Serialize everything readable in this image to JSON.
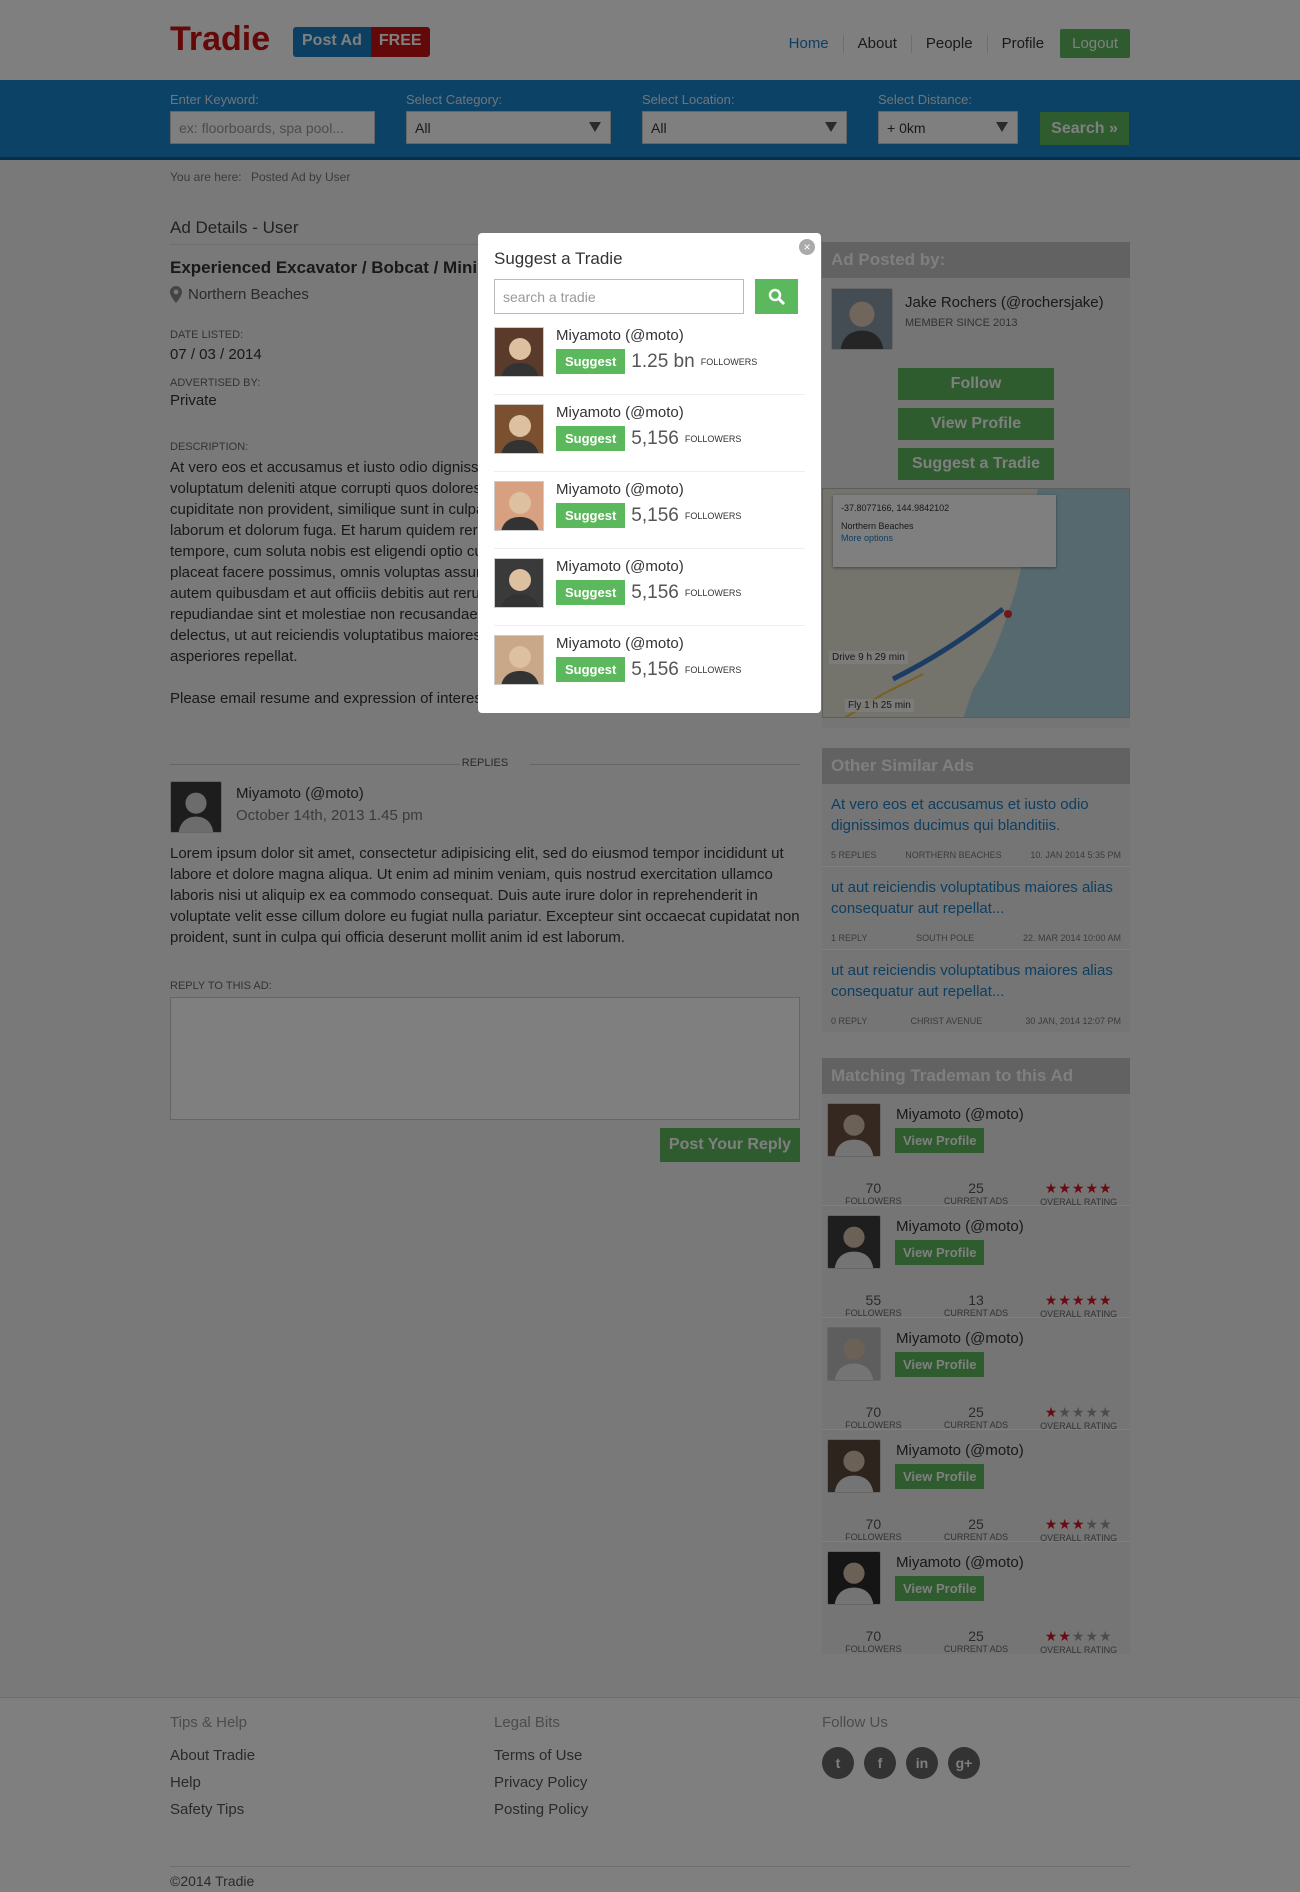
{
  "header": {
    "logo": "Tradie",
    "post_ad": "Post Ad",
    "free": "FREE",
    "nav": [
      "Home",
      "About",
      "People",
      "Profile"
    ],
    "logout": "Logout"
  },
  "search": {
    "keyword_label": "Enter Keyword:",
    "keyword_placeholder": "ex: floorboards, spa pool...",
    "category_label": "Select Category:",
    "category_value": "All",
    "location_label": "Select Location:",
    "location_value": "All",
    "distance_label": "Select Distance:",
    "distance_value": "+ 0km",
    "button": "Search »"
  },
  "breadcrumb": {
    "prefix": "You are here:",
    "current": "Posted Ad by User"
  },
  "ad": {
    "section_title": "Ad Details - User",
    "title": "Experienced Excavator / Bobcat / Mini",
    "location": "Northern Beaches",
    "date_label": "DATE LISTED:",
    "date": "07 / 03 / 2014",
    "advertised_label": "ADVERTISED BY:",
    "advertised": "Private",
    "desc_label": "DESCRIPTION:",
    "description": "At vero eos et accusamus et iusto odio dignissimos ducimus qui blanditiis praesentium voluptatum deleniti atque corrupti quos dolores et quas molestias excepturi sint occaecati cupiditate non provident, similique sunt in culpa qui officia deserunt mollitia animi, id est laborum et dolorum fuga. Et harum quidem rerum facilis est et expedita distinctio. Nam libero tempore, cum soluta nobis est eligendi optio cumque nihil impedit quo minus id quod maxime placeat facere possimus, omnis voluptas assumenda est, omnis dolor repellendus. Temporibus autem quibusdam et aut officiis debitis aut rerum necessitatibus saepe eveniet ut et voluptates repudiandae sint et molestiae non recusandae. Itaque earum rerum hic tenetur a sapiente delectus, ut aut reiciendis voluptatibus maiores alias consequatur aut perferendis doloribus asperiores repellat.",
    "email_note": "Please email resume and expression of interest."
  },
  "replies": {
    "label": "REPLIES",
    "author": "Miyamoto (@moto)",
    "date": "October 14th, 2013 1.45 pm",
    "body": "Lorem ipsum dolor sit amet, consectetur adipisicing elit, sed do eiusmod tempor incididunt ut labore et dolore magna aliqua. Ut enim ad minim veniam, quis nostrud exercitation ullamco laboris nisi ut aliquip ex ea commodo consequat. Duis aute irure dolor in reprehenderit in voluptate velit esse cillum dolore eu fugiat nulla pariatur. Excepteur sint occaecat cupidatat non proident, sunt in culpa qui officia deserunt mollit anim id est laborum.",
    "reply_label": "REPLY TO THIS AD:",
    "post_button": "Post Your Reply"
  },
  "poster": {
    "heading": "Ad Posted by:",
    "name": "Jake Rochers  (@rochersjake)",
    "since": "MEMBER SINCE 2013",
    "follow": "Follow",
    "view_profile": "View Profile",
    "suggest": "Suggest a Tradie",
    "map_coords": "-37.8077166, 144.9842102",
    "map_place": "Northern Beaches",
    "map_more": "More options",
    "map_drive": "Drive 9 h 29 min",
    "map_fly": "Fly 1 h 25 min"
  },
  "similar": {
    "heading": "Other Similar Ads",
    "items": [
      {
        "title": "At vero eos et accusamus et iusto odio dignissimos ducimus qui blanditiis.",
        "replies": "5 REPLIES",
        "place": "NORTHERN BEACHES",
        "date": "10. JAN 2014 5:35 PM"
      },
      {
        "title": "ut aut reiciendis voluptatibus maiores alias consequatur aut repellat...",
        "replies": "1 REPLY",
        "place": "SOUTH POLE",
        "date": "22. MAR 2014 10:00 AM"
      },
      {
        "title": "ut aut reiciendis voluptatibus maiores alias consequatur aut repellat...",
        "replies": "0 REPLY",
        "place": "CHRIST AVENUE",
        "date": "30 JAN, 2014 12:07 PM"
      }
    ]
  },
  "matching": {
    "heading": "Matching Trademan to this Ad",
    "followers_label": "FOLLOWERS",
    "ads_label": "CURRENT ADS",
    "rating_label": "OVERALL RATING",
    "view_profile": "View Profile",
    "items": [
      {
        "name": "Miyamoto (@moto)",
        "followers": "70",
        "ads": "25",
        "rating": 5
      },
      {
        "name": "Miyamoto (@moto)",
        "followers": "55",
        "ads": "13",
        "rating": 5
      },
      {
        "name": "Miyamoto (@moto)",
        "followers": "70",
        "ads": "25",
        "rating": 1
      },
      {
        "name": "Miyamoto (@moto)",
        "followers": "70",
        "ads": "25",
        "rating": 3
      },
      {
        "name": "Miyamoto (@moto)",
        "followers": "70",
        "ads": "25",
        "rating": 2
      }
    ]
  },
  "footer": {
    "col1_title": "Tips & Help",
    "col1": [
      "About Tradie",
      "Help",
      "Safety Tips"
    ],
    "col2_title": "Legal Bits",
    "col2": [
      "Terms of Use",
      "Privacy Policy",
      "Posting Policy"
    ],
    "col3_title": "Follow Us",
    "copyright": "©2014 Tradie"
  },
  "modal": {
    "title": "Suggest a Tradie",
    "search_placeholder": "search a tradie",
    "suggest_label": "Suggest",
    "followers_label": "FOLLOWERS",
    "items": [
      {
        "name": "Miyamoto (@moto)",
        "count": "1.25 bn"
      },
      {
        "name": "Miyamoto (@moto)",
        "count": "5,156"
      },
      {
        "name": "Miyamoto (@moto)",
        "count": "5,156"
      },
      {
        "name": "Miyamoto (@moto)",
        "count": "5,156"
      },
      {
        "name": "Miyamoto (@moto)",
        "count": "5,156"
      }
    ]
  },
  "colors": {
    "accent": "#1a84cf",
    "brand_red": "#c81212",
    "green": "#5cb85c",
    "star": "#d6141f"
  }
}
